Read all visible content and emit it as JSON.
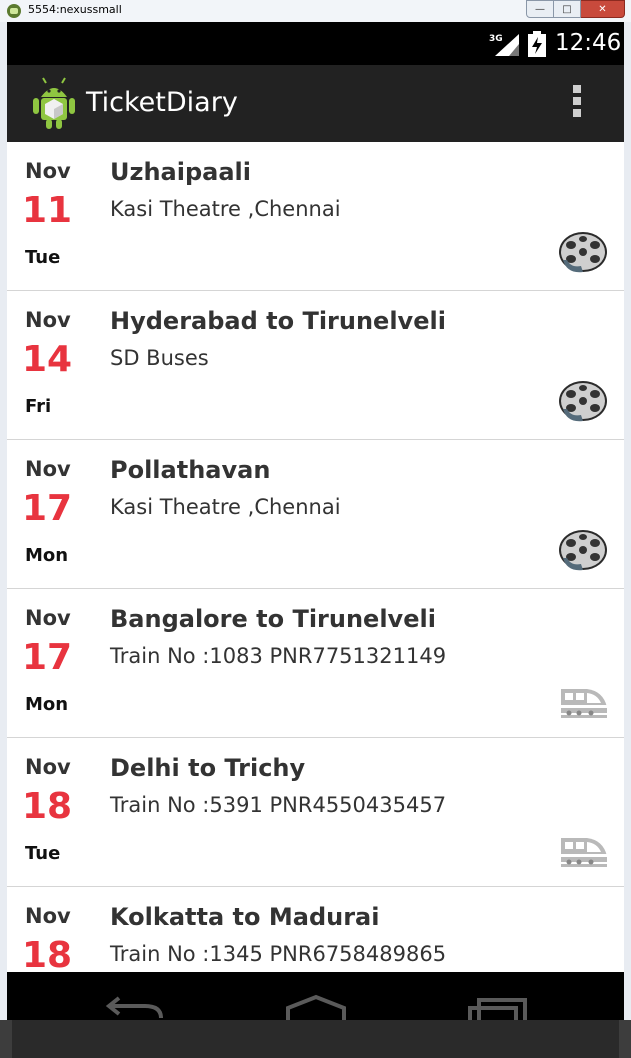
{
  "window": {
    "title": "5554:nexussmall"
  },
  "status_bar": {
    "network": "3G",
    "time": "12:46"
  },
  "action_bar": {
    "title": "TicketDiary"
  },
  "tickets": [
    {
      "month": "Nov",
      "day": "11",
      "weekday": "Tue",
      "title": "Uzhaipaali",
      "subtitle": "Kasi Theatre ,Chennai",
      "icon": "film-reel-icon"
    },
    {
      "month": "Nov",
      "day": "14",
      "weekday": "Fri",
      "title": "Hyderabad to Tirunelveli",
      "subtitle": "SD Buses",
      "icon": "film-reel-icon"
    },
    {
      "month": "Nov",
      "day": "17",
      "weekday": "Mon",
      "title": "Pollathavan",
      "subtitle": "Kasi Theatre ,Chennai",
      "icon": "film-reel-icon"
    },
    {
      "month": "Nov",
      "day": "17",
      "weekday": "Mon",
      "title": "Bangalore to Tirunelveli",
      "subtitle": "Train No :1083 PNR7751321149",
      "icon": "train-icon"
    },
    {
      "month": "Nov",
      "day": "18",
      "weekday": "Tue",
      "title": "Delhi to Trichy",
      "subtitle": "Train No :5391 PNR4550435457",
      "icon": "train-icon"
    },
    {
      "month": "Nov",
      "day": "18",
      "weekday": "",
      "title": "Kolkatta to Madurai",
      "subtitle": "Train No :1345 PNR6758489865",
      "icon": ""
    }
  ],
  "colors": {
    "date": "#e8343f",
    "action_bar": "#222222",
    "status_bar": "#000000"
  }
}
